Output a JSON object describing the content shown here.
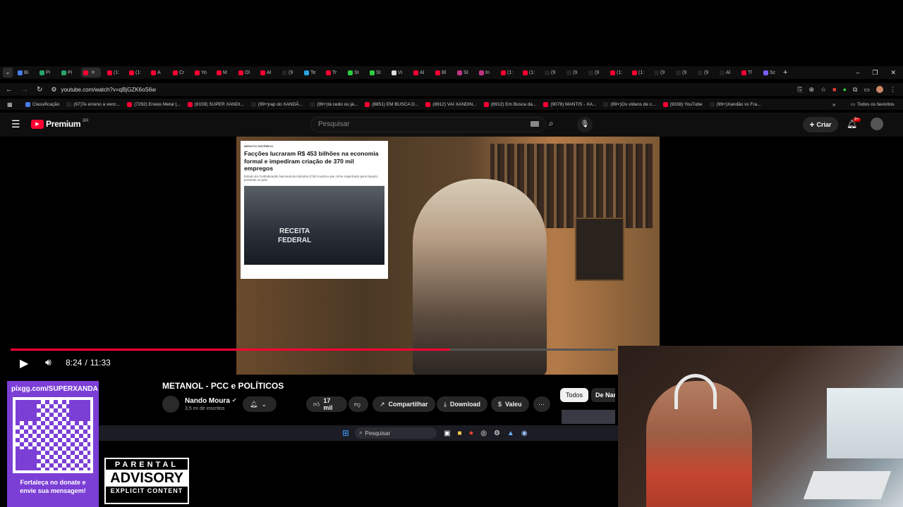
{
  "browser": {
    "tabs": [
      {
        "label": "Bi",
        "color": "#4a7cf0"
      },
      {
        "label": "Pi",
        "color": "#29a36a"
      },
      {
        "label": "Pi",
        "color": "#29a36a"
      },
      {
        "label": "",
        "color": "#ff0033",
        "active": true
      },
      {
        "label": "(1:",
        "color": "#ff0033"
      },
      {
        "label": "(1:",
        "color": "#ff0033"
      },
      {
        "label": "A",
        "color": "#ff0033"
      },
      {
        "label": "Cr",
        "color": "#ff0033"
      },
      {
        "label": "Yo",
        "color": "#ff0033"
      },
      {
        "label": "M",
        "color": "#ff0033"
      },
      {
        "label": "Ol",
        "color": "#ff0033"
      },
      {
        "label": "Al",
        "color": "#ff0033"
      },
      {
        "label": "(9",
        "color": "#222"
      },
      {
        "label": "Te",
        "color": "#2aa3e0"
      },
      {
        "label": "Tr",
        "color": "#ff0033"
      },
      {
        "label": "St",
        "color": "#2ecc40"
      },
      {
        "label": "St",
        "color": "#2ecc40"
      },
      {
        "label": "Vi",
        "color": "#dddddd"
      },
      {
        "label": "Al",
        "color": "#ff0033"
      },
      {
        "label": "Bl",
        "color": "#ff0033"
      },
      {
        "label": "St",
        "color": "#c13584"
      },
      {
        "label": "In",
        "color": "#c13584"
      },
      {
        "label": "(1:",
        "color": "#ff0033"
      },
      {
        "label": "(1:",
        "color": "#ff0033"
      },
      {
        "label": "(9",
        "color": "#222"
      },
      {
        "label": "(9",
        "color": "#222"
      },
      {
        "label": "(9",
        "color": "#222"
      },
      {
        "label": "(1:",
        "color": "#ff0033"
      },
      {
        "label": "(1:",
        "color": "#ff0033"
      },
      {
        "label": "(9",
        "color": "#222"
      },
      {
        "label": "(9",
        "color": "#222"
      },
      {
        "label": "(9",
        "color": "#222"
      },
      {
        "label": "Al",
        "color": "#222"
      },
      {
        "label": "Tl",
        "color": "#ff0033"
      },
      {
        "label": "Sc",
        "color": "#7b5cff"
      }
    ],
    "url": "youtube.com/watch?v=qBjGZK6oS6w",
    "bookmarks": [
      {
        "label": "Classificação",
        "color": "#4a7cf0"
      },
      {
        "label": "(97)Te ensino a venc...",
        "color": "#222"
      },
      {
        "label": "(7292) Enéas Metal |...",
        "color": "#ff0033"
      },
      {
        "label": "(8159) SUPER XANDI...",
        "color": "#ff0033"
      },
      {
        "label": "(99+)rap do XANDÃ...",
        "color": "#222"
      },
      {
        "label": "(99+)tá cedo ou já...",
        "color": "#222"
      },
      {
        "label": "(8851) EM BUSCA D...",
        "color": "#ff0033"
      },
      {
        "label": "(8912) VAI XANDIN...",
        "color": "#ff0033"
      },
      {
        "label": "(8912) Em Busca da...",
        "color": "#ff0033"
      },
      {
        "label": "(9078) MANTIS - XA...",
        "color": "#ff0033"
      },
      {
        "label": "(99+)Os vídeos de c...",
        "color": "#222"
      },
      {
        "label": "(9338) YouTube",
        "color": "#ff0033"
      },
      {
        "label": "(99+)Xandão vs Fra...",
        "color": "#222"
      }
    ],
    "all_bookmarks": "Todos os favoritos"
  },
  "youtube": {
    "logo": "Premium",
    "region": "BR",
    "search_placeholder": "Pesquisar",
    "create_label": "Criar",
    "notif_count": "9+"
  },
  "video": {
    "news": {
      "kicker": "IMPACTO SISTÊMICO",
      "headline": "Facções lucraram R$ 453 bilhões na economia formal e impediram criação de 370 mil empregos",
      "sub": "Estudo da Confederação Nacional da Indústria (CNI) mostrou que crime organizado gera impacto profundo no país",
      "photo_text_1": "RECEITA",
      "photo_text_2": "FEDERAL"
    },
    "time_current": "8:24",
    "time_separator": "/",
    "time_total": "11:33",
    "progress": 0.727
  },
  "details": {
    "title": "METANOL - PCC e POLÍTICOS",
    "channel": "Nando Moura",
    "subscribers": "3,5 mi de inscritos",
    "likes": "17 mil",
    "share": "Compartilhar",
    "download": "Download",
    "thanks": "Valeu",
    "chips": [
      "Todos",
      "De Nan"
    ]
  },
  "overlays": {
    "donate_url": "pixgg.com/SUPERXANDA",
    "donate_msg_1": "Fortaleça no donate e",
    "donate_msg_2": "envie sua mensagem!",
    "advisory_1": "PARENTAL",
    "advisory_2": "ADVISORY",
    "advisory_3": "EXPLICIT CONTENT"
  },
  "taskbar": {
    "search": "Pesquisar"
  }
}
